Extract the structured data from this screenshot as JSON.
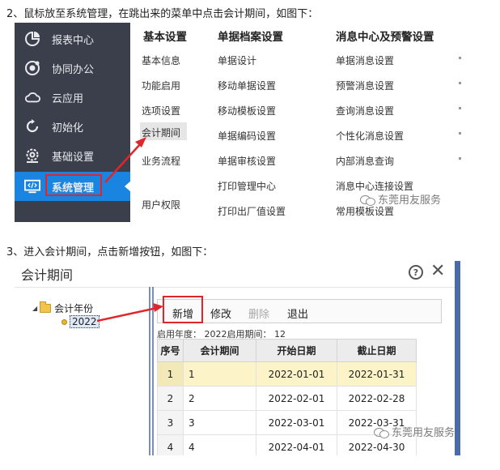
{
  "step2_text": "2、鼠标放至系统管理，在跳出来的菜单中点击会计期间，如图下：",
  "step3_text": "3、进入会计期间，点击新增按钮，如图下：",
  "menu_screenshot": {
    "sidebar": {
      "items": [
        {
          "label": "报表中心",
          "icon": "report-chart-icon"
        },
        {
          "label": "协同办公",
          "icon": "collaboration-icon"
        },
        {
          "label": "云应用",
          "icon": "cloud-icon"
        },
        {
          "label": "初始化",
          "icon": "refresh-icon"
        },
        {
          "label": "基础设置",
          "icon": "gear-icon"
        },
        {
          "label": "系统管理",
          "icon": "monitor-code-icon",
          "active": true
        }
      ]
    },
    "columns": {
      "basic": {
        "title": "基本设置",
        "items": [
          "基本信息",
          "功能启用",
          "选项设置",
          "会计期间",
          "业务流程",
          "用户权限"
        ]
      },
      "archive": {
        "title": "单据档案设置",
        "items": [
          "单据设计",
          "移动单据设置",
          "移动模板设置",
          "单据编码设置",
          "单据审核设置",
          "打印管理中心",
          "打印出厂值设置"
        ]
      },
      "message": {
        "title": "消息中心及预警设置",
        "items": [
          "单据消息设置",
          "预警消息设置",
          "查询消息设置",
          "个性化消息设置",
          "内部消息查询",
          "消息中心连接设置",
          "常用模板设置"
        ]
      }
    },
    "watermark": "东莞用友服务"
  },
  "dialog_screenshot": {
    "title": "会计期间",
    "help_symbol": "?",
    "close_symbol": "✕",
    "tree": {
      "root_label": "会计年份",
      "root_toggle": "◢",
      "child_label": "2022"
    },
    "toolbar": {
      "new_label": "新增",
      "edit_label": "修改",
      "delete_label": "删除",
      "exit_label": "退出"
    },
    "year_info": "启用年度： 2022启用期间： 12",
    "table": {
      "headers": [
        "序号",
        "会计期间",
        "开始日期",
        "截止日期"
      ],
      "rows": [
        [
          "1",
          "1",
          "2022-01-01",
          "2022-01-31"
        ],
        [
          "2",
          "2",
          "2022-02-01",
          "2022-02-28"
        ],
        [
          "3",
          "3",
          "2022-03-01",
          "2022-03-31"
        ],
        [
          "4",
          "4",
          "2022-04-01",
          "2022-04-30"
        ]
      ],
      "selected_row": 0
    },
    "watermark": "东莞用友服务"
  },
  "colors": {
    "sidebar_bg": "#3a3f4b",
    "active_blue": "#1a85e0",
    "highlight_red": "#e0262a",
    "selected_row_bg": "#fdf3c8"
  }
}
